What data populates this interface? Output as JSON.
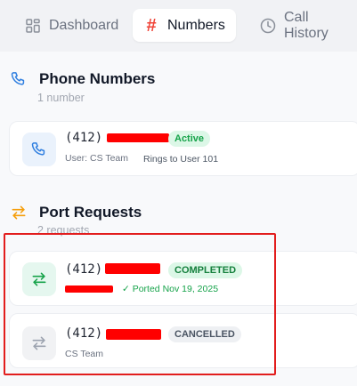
{
  "tabs": [
    {
      "label": "Dashboard",
      "icon": "grid-icon",
      "active": false
    },
    {
      "label": "Numbers",
      "icon": "hash-icon",
      "active": true
    },
    {
      "label": "Call History",
      "icon": "clock-icon",
      "active": false
    }
  ],
  "hash_symbol": "#",
  "phone_section": {
    "title": "Phone Numbers",
    "subtitle": "1 number"
  },
  "phone_numbers": [
    {
      "area": "(412)",
      "status": "Active",
      "user": "User: CS Team",
      "rings": "Rings to User 101"
    }
  ],
  "port_section": {
    "title": "Port Requests",
    "subtitle": "2 requests"
  },
  "port_requests": [
    {
      "area": "(412)",
      "status": "COMPLETED",
      "ported": "✓ Ported Nov 19, 2025",
      "owner": ""
    },
    {
      "area": "(412)",
      "status": "CANCELLED",
      "ported": "",
      "owner": "CS Team"
    }
  ],
  "colors": {
    "accent": "#2f7fe0",
    "active_badge_bg": "#dcf7e7",
    "active_badge_text": "#16a34a",
    "orange": "#f59e0b",
    "redaction": "#ff0000",
    "highlight_border": "#e21d1d"
  }
}
